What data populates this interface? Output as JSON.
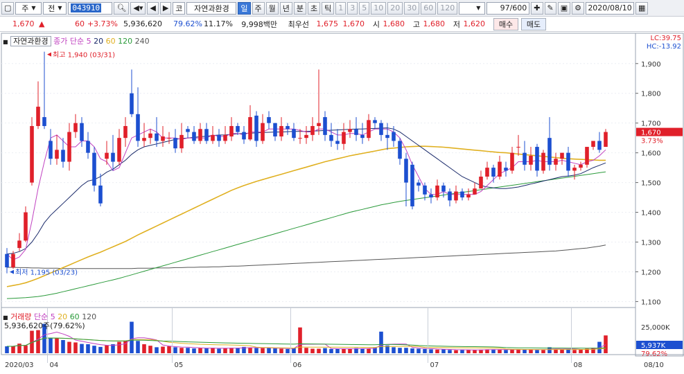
{
  "toolbar": {
    "market": "주",
    "period_mode": "전",
    "code": "043910",
    "market_tag": "코",
    "stock_name": "자연과환경",
    "periods": [
      "일",
      "주",
      "월",
      "년",
      "분",
      "초",
      "틱"
    ],
    "selected_period": "일",
    "numbers": [
      "1",
      "3",
      "5",
      "10",
      "20",
      "30",
      "60",
      "120"
    ],
    "count": "97/600",
    "date": "2020/08/10"
  },
  "quote": {
    "price": "1,670",
    "arrow": "▲",
    "change": "60",
    "change_pct": "+3.73%",
    "volume": "5,936,620",
    "volume_ratio": "79.62%",
    "turnover": "11.17%",
    "amount": "9,998백만",
    "best_label": "최우선",
    "best_ask": "1,675",
    "best_bid": "1,670",
    "open_label": "시",
    "open": "1,680",
    "high_label": "고",
    "high": "1,680",
    "low_label": "저",
    "low": "1,620",
    "buy_label": "매수",
    "sell_label": "매도"
  },
  "price_panel": {
    "title": "자연과환경",
    "ma_label": "종가 단순",
    "ma_periods": [
      "5",
      "20",
      "60",
      "120",
      "240"
    ],
    "lc": "LC:39.75",
    "hc": "HC:-13.92",
    "current_price": "1,670",
    "current_pct": "3.73%",
    "high_note": "최고 1,940 (03/31)",
    "low_note": "최저 1,195 (03/23)",
    "y_ticks": [
      "1,900",
      "1,800",
      "1,700",
      "1,600",
      "1,500",
      "1,400",
      "1,300",
      "1,200",
      "1,100"
    ]
  },
  "volume_panel": {
    "title": "거래량",
    "ma_label": "단순",
    "ma_periods": [
      "5",
      "20",
      "60",
      "120"
    ],
    "value_label": "5,936,620주(79.62%)",
    "y_tick": "25,000K",
    "current": "5,937K",
    "current_pct": "79.62%"
  },
  "x_axis": {
    "labels": [
      "2020/03",
      "04",
      "05",
      "06",
      "07",
      "08",
      "08/10"
    ]
  },
  "colors": {
    "up": "#e0202a",
    "down": "#1c4fd0",
    "ma5": "#c040c0",
    "ma20": "#1a2a6a",
    "ma60": "#e0b020",
    "ma120": "#2a9a3a",
    "ma240": "#555555"
  },
  "chart_data": {
    "type": "candlestick",
    "title": "자연과환경",
    "ylim": [
      1080,
      1960
    ],
    "x": [
      "03/23",
      "03/24",
      "03/25",
      "03/26",
      "03/27",
      "03/30",
      "03/31",
      "04/01",
      "04/02",
      "04/03",
      "04/06",
      "04/07",
      "04/08",
      "04/09",
      "04/10",
      "04/13",
      "04/14",
      "04/16",
      "04/17",
      "04/20",
      "04/21",
      "04/22",
      "04/23",
      "04/24",
      "04/27",
      "04/28",
      "04/29",
      "05/04",
      "05/06",
      "05/07",
      "05/08",
      "05/11",
      "05/12",
      "05/13",
      "05/14",
      "05/15",
      "05/18",
      "05/19",
      "05/20",
      "05/21",
      "05/22",
      "05/25",
      "05/26",
      "05/27",
      "05/28",
      "05/29",
      "06/01",
      "06/02",
      "06/03",
      "06/04",
      "06/05",
      "06/08",
      "06/09",
      "06/10",
      "06/11",
      "06/12",
      "06/15",
      "06/16",
      "06/17",
      "06/18",
      "06/19",
      "06/22",
      "06/23",
      "06/24",
      "06/25",
      "06/26",
      "06/29",
      "06/30",
      "07/01",
      "07/02",
      "07/03",
      "07/06",
      "07/07",
      "07/08",
      "07/09",
      "07/10",
      "07/13",
      "07/14",
      "07/15",
      "07/16",
      "07/17",
      "07/20",
      "07/21",
      "07/22",
      "07/23",
      "07/24",
      "07/27",
      "07/28",
      "07/29",
      "07/30",
      "07/31",
      "08/03",
      "08/04",
      "08/05",
      "08/06",
      "08/07",
      "08/10"
    ],
    "open": [
      1260,
      1215,
      1280,
      1305,
      1500,
      1690,
      1720,
      1640,
      1580,
      1610,
      1570,
      1670,
      1700,
      1640,
      1600,
      1490,
      1580,
      1600,
      1570,
      1650,
      1800,
      1730,
      1640,
      1650,
      1665,
      1640,
      1650,
      1650,
      1615,
      1680,
      1670,
      1640,
      1680,
      1640,
      1660,
      1640,
      1655,
      1690,
      1670,
      1645,
      1725,
      1640,
      1720,
      1700,
      1655,
      1690,
      1680,
      1650,
      1650,
      1660,
      1690,
      1720,
      1660,
      1640,
      1630,
      1670,
      1680,
      1660,
      1650,
      1710,
      1700,
      1660,
      1670,
      1640,
      1580,
      1560,
      1500,
      1490,
      1460,
      1450,
      1490,
      1470,
      1440,
      1470,
      1450,
      1460,
      1480,
      1520,
      1550,
      1520,
      1550,
      1540,
      1620,
      1600,
      1560,
      1620,
      1540,
      1650,
      1560,
      1580,
      1600,
      1540,
      1550,
      1560,
      1620,
      1640,
      1620
    ],
    "close": [
      1215,
      1260,
      1305,
      1400,
      1690,
      1755,
      1690,
      1580,
      1610,
      1570,
      1670,
      1700,
      1640,
      1600,
      1490,
      1430,
      1600,
      1570,
      1650,
      1690,
      1730,
      1640,
      1650,
      1665,
      1640,
      1655,
      1650,
      1615,
      1660,
      1670,
      1640,
      1680,
      1640,
      1660,
      1640,
      1660,
      1690,
      1670,
      1645,
      1720,
      1640,
      1700,
      1700,
      1655,
      1690,
      1680,
      1650,
      1650,
      1660,
      1690,
      1700,
      1660,
      1640,
      1630,
      1670,
      1680,
      1660,
      1650,
      1710,
      1700,
      1660,
      1650,
      1640,
      1580,
      1500,
      1420,
      1490,
      1460,
      1450,
      1490,
      1470,
      1440,
      1470,
      1450,
      1460,
      1480,
      1520,
      1550,
      1520,
      1570,
      1540,
      1600,
      1620,
      1560,
      1590,
      1540,
      1600,
      1560,
      1580,
      1600,
      1540,
      1550,
      1560,
      1620,
      1640,
      1610,
      1670
    ],
    "high": [
      1280,
      1270,
      1330,
      1420,
      1720,
      1840,
      1940,
      1680,
      1660,
      1650,
      1700,
      1730,
      1720,
      1670,
      1620,
      1530,
      1640,
      1660,
      1680,
      1720,
      1880,
      1820,
      1700,
      1680,
      1720,
      1690,
      1670,
      1680,
      1700,
      1690,
      1690,
      1700,
      1700,
      1690,
      1680,
      1690,
      1720,
      1700,
      1690,
      1760,
      1740,
      1730,
      1740,
      1700,
      1720,
      1700,
      1700,
      1680,
      1690,
      1720,
      1880,
      1740,
      1700,
      1680,
      1700,
      1710,
      1720,
      1700,
      1730,
      1720,
      1710,
      1700,
      1690,
      1650,
      1600,
      1570,
      1510,
      1500,
      1480,
      1510,
      1500,
      1480,
      1490,
      1480,
      1480,
      1500,
      1540,
      1570,
      1560,
      1590,
      1570,
      1620,
      1660,
      1640,
      1620,
      1630,
      1610,
      1720,
      1600,
      1600,
      1620,
      1560,
      1570,
      1600,
      1640,
      1670,
      1680
    ],
    "low": [
      1195,
      1210,
      1270,
      1300,
      1490,
      1680,
      1680,
      1560,
      1560,
      1550,
      1540,
      1650,
      1620,
      1580,
      1470,
      1420,
      1560,
      1540,
      1560,
      1620,
      1720,
      1620,
      1620,
      1630,
      1620,
      1620,
      1630,
      1600,
      1600,
      1650,
      1630,
      1630,
      1630,
      1630,
      1620,
      1630,
      1640,
      1660,
      1630,
      1640,
      1620,
      1630,
      1680,
      1640,
      1640,
      1660,
      1640,
      1630,
      1630,
      1640,
      1660,
      1640,
      1620,
      1610,
      1610,
      1650,
      1640,
      1630,
      1640,
      1680,
      1640,
      1610,
      1620,
      1560,
      1420,
      1410,
      1470,
      1440,
      1430,
      1440,
      1450,
      1420,
      1430,
      1440,
      1440,
      1460,
      1480,
      1510,
      1500,
      1510,
      1520,
      1530,
      1590,
      1540,
      1540,
      1520,
      1530,
      1540,
      1540,
      1560,
      1520,
      1510,
      1540,
      1550,
      1610,
      1600,
      1620
    ],
    "volume": [
      2300,
      2300,
      3200,
      2600,
      7500,
      7700,
      9800,
      5200,
      5000,
      4400,
      3800,
      3600,
      3100,
      3000,
      2500,
      2100,
      2600,
      3000,
      3800,
      4200,
      10500,
      4100,
      3000,
      2500,
      2000,
      2200,
      2300,
      2000,
      1800,
      1800,
      1600,
      1700,
      1600,
      1800,
      1500,
      1700,
      1800,
      1800,
      2100,
      1800,
      1700,
      1700,
      1800,
      1600,
      1500,
      1400,
      1700,
      8600,
      1800,
      1500,
      1500,
      1700,
      1400,
      1400,
      1400,
      1500,
      1700,
      1600,
      1500,
      1800,
      7200,
      2600,
      2000,
      1800,
      1800,
      1600,
      1500,
      1400,
      1300,
      1200,
      1300,
      1100,
      1000,
      1200,
      1100,
      1100,
      1200,
      1300,
      1300,
      1200,
      1100,
      1200,
      1300,
      1200,
      1300,
      1100,
      1100,
      2000,
      1500,
      1200,
      1300,
      1100,
      1200,
      1500,
      1800,
      3800,
      5937
    ],
    "series": [
      {
        "name": "5",
        "values": [
          1260,
          1240,
          1250,
          1275,
          1370,
          1480,
          1570,
          1650,
          1660,
          1640,
          1620,
          1620,
          1640,
          1640,
          1620,
          1580,
          1570,
          1540,
          1550,
          1600,
          1650,
          1660,
          1670,
          1680,
          1670,
          1650,
          1650,
          1650,
          1645,
          1650,
          1650,
          1650,
          1650,
          1660,
          1655,
          1655,
          1665,
          1665,
          1660,
          1670,
          1670,
          1670,
          1680,
          1680,
          1680,
          1680,
          1680,
          1675,
          1670,
          1670,
          1680,
          1680,
          1670,
          1660,
          1660,
          1665,
          1665,
          1660,
          1670,
          1680,
          1680,
          1680,
          1670,
          1650,
          1610,
          1560,
          1520,
          1480,
          1460,
          1460,
          1470,
          1460,
          1460,
          1460,
          1460,
          1460,
          1470,
          1490,
          1510,
          1530,
          1540,
          1550,
          1570,
          1570,
          1570,
          1575,
          1570,
          1570,
          1570,
          1575,
          1570,
          1565,
          1560,
          1570,
          1575,
          1590,
          1610
        ]
      },
      {
        "name": "20",
        "values": [
          1260,
          1262,
          1268,
          1278,
          1300,
          1330,
          1365,
          1390,
          1410,
          1430,
          1450,
          1470,
          1490,
          1505,
          1510,
          1520,
          1535,
          1545,
          1560,
          1575,
          1595,
          1610,
          1620,
          1625,
          1630,
          1635,
          1640,
          1645,
          1648,
          1650,
          1652,
          1654,
          1656,
          1658,
          1660,
          1660,
          1662,
          1664,
          1665,
          1666,
          1667,
          1668,
          1669,
          1670,
          1670,
          1671,
          1672,
          1672,
          1672,
          1673,
          1674,
          1675,
          1676,
          1677,
          1678,
          1679,
          1680,
          1680,
          1681,
          1682,
          1683,
          1684,
          1680,
          1670,
          1655,
          1640,
          1625,
          1610,
          1595,
          1580,
          1565,
          1550,
          1535,
          1520,
          1510,
          1500,
          1490,
          1485,
          1482,
          1480,
          1480,
          1482,
          1485,
          1490,
          1495,
          1500,
          1505,
          1510,
          1515,
          1520,
          1522,
          1525,
          1530,
          1540,
          1550,
          1558,
          1566
        ]
      },
      {
        "name": "60",
        "values": [
          1150,
          1154,
          1158,
          1163,
          1170,
          1178,
          1187,
          1196,
          1205,
          1214,
          1223,
          1232,
          1241,
          1250,
          1258,
          1266,
          1275,
          1284,
          1293,
          1302,
          1313,
          1324,
          1334,
          1344,
          1354,
          1364,
          1374,
          1384,
          1394,
          1404,
          1414,
          1424,
          1434,
          1444,
          1454,
          1464,
          1474,
          1482,
          1490,
          1497,
          1504,
          1510,
          1516,
          1522,
          1528,
          1534,
          1540,
          1546,
          1552,
          1558,
          1564,
          1570,
          1575,
          1580,
          1585,
          1590,
          1594,
          1598,
          1602,
          1606,
          1610,
          1614,
          1616,
          1618,
          1620,
          1621,
          1622,
          1622,
          1621,
          1620,
          1619,
          1617,
          1615,
          1613,
          1611,
          1609,
          1607,
          1605,
          1603,
          1601,
          1600,
          1598,
          1596,
          1594,
          1592,
          1590,
          1588,
          1586,
          1584,
          1582,
          1580,
          1579,
          1578,
          1577,
          1576,
          1575,
          1575
        ]
      },
      {
        "name": "120",
        "values": [
          1110,
          1111,
          1112,
          1113,
          1115,
          1117,
          1120,
          1124,
          1128,
          1133,
          1138,
          1143,
          1148,
          1153,
          1158,
          1163,
          1168,
          1173,
          1178,
          1184,
          1190,
          1196,
          1202,
          1208,
          1214,
          1220,
          1226,
          1232,
          1238,
          1244,
          1250,
          1256,
          1262,
          1268,
          1274,
          1280,
          1286,
          1292,
          1298,
          1304,
          1310,
          1316,
          1322,
          1328,
          1334,
          1340,
          1346,
          1352,
          1358,
          1364,
          1370,
          1376,
          1382,
          1388,
          1394,
          1400,
          1405,
          1410,
          1415,
          1420,
          1425,
          1429,
          1433,
          1437,
          1440,
          1443,
          1446,
          1449,
          1452,
          1455,
          1458,
          1461,
          1464,
          1467,
          1470,
          1473,
          1476,
          1479,
          1482,
          1485,
          1488,
          1491,
          1494,
          1497,
          1500,
          1503,
          1506,
          1509,
          1512,
          1515,
          1518,
          1521,
          1524,
          1527,
          1530,
          1533,
          1536
        ]
      },
      {
        "name": "240",
        "values": [
          1215,
          1215,
          1214,
          1214,
          1213,
          1213,
          1212,
          1212,
          1212,
          1211,
          1211,
          1211,
          1211,
          1211,
          1211,
          1211,
          1211,
          1211,
          1211,
          1211,
          1211,
          1212,
          1212,
          1212,
          1213,
          1213,
          1213,
          1214,
          1214,
          1215,
          1215,
          1216,
          1216,
          1217,
          1217,
          1218,
          1219,
          1219,
          1220,
          1221,
          1222,
          1223,
          1224,
          1225,
          1226,
          1227,
          1228,
          1229,
          1230,
          1231,
          1232,
          1233,
          1234,
          1235,
          1236,
          1237,
          1238,
          1239,
          1240,
          1241,
          1242,
          1243,
          1244,
          1245,
          1246,
          1247,
          1248,
          1249,
          1250,
          1251,
          1252,
          1253,
          1254,
          1255,
          1256,
          1257,
          1258,
          1259,
          1260,
          1261,
          1262,
          1263,
          1264,
          1265,
          1266,
          1267,
          1268,
          1269,
          1270,
          1272,
          1274,
          1276,
          1278,
          1280,
          1283,
          1286,
          1290
        ]
      }
    ]
  }
}
